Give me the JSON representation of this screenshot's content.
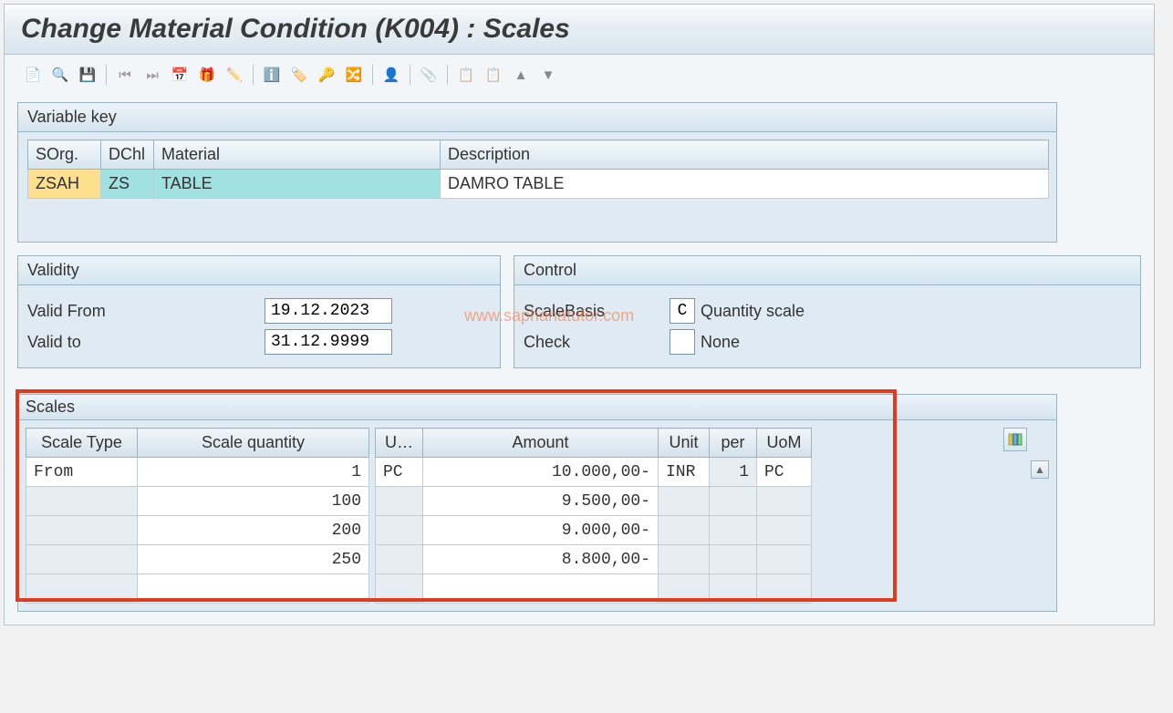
{
  "title": "Change Material Condition (K004) : Scales",
  "watermark": "www.saphanatutor.com",
  "variable_key": {
    "label": "Variable key",
    "headers": [
      "SOrg.",
      "DChl",
      "Material",
      "Description"
    ],
    "row": {
      "sorg": "ZSAH",
      "dchl": "ZS",
      "material": "TABLE",
      "description": "DAMRO TABLE"
    }
  },
  "validity": {
    "label": "Validity",
    "from_label": "Valid From",
    "from_value": "19.12.2023",
    "to_label": "Valid to",
    "to_value": "31.12.9999"
  },
  "control": {
    "label": "Control",
    "scalebasis_label": "ScaleBasis",
    "scalebasis_code": "C",
    "scalebasis_text": "Quantity scale",
    "check_label": "Check",
    "check_code": "",
    "check_text": "None"
  },
  "scales": {
    "label": "Scales",
    "headers": {
      "type": "Scale Type",
      "qty": "Scale quantity",
      "u1": "U…",
      "amount": "Amount",
      "unit": "Unit",
      "per": "per",
      "uom": "UoM"
    },
    "rows": [
      {
        "type": "From",
        "qty": "1",
        "u1": "PC",
        "amount": "10.000,00-",
        "unit": "INR",
        "per": "1",
        "uom": "PC"
      },
      {
        "type": "",
        "qty": "100",
        "u1": "",
        "amount": "9.500,00-",
        "unit": "",
        "per": "",
        "uom": ""
      },
      {
        "type": "",
        "qty": "200",
        "u1": "",
        "amount": "9.000,00-",
        "unit": "",
        "per": "",
        "uom": ""
      },
      {
        "type": "",
        "qty": "250",
        "u1": "",
        "amount": "8.800,00-",
        "unit": "",
        "per": "",
        "uom": ""
      }
    ]
  }
}
